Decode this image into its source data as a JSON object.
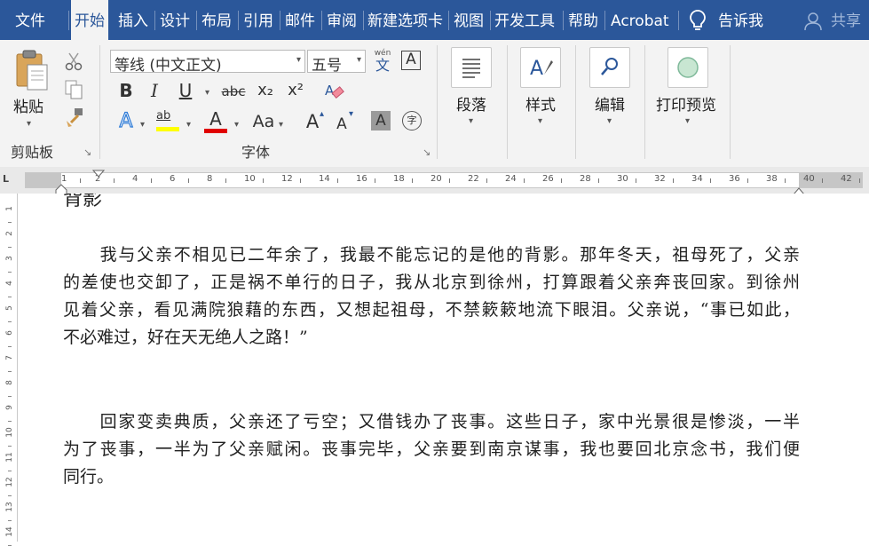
{
  "tabs": {
    "file": "文件",
    "home": "开始",
    "insert": "插入",
    "design": "设计",
    "layout": "布局",
    "references": "引用",
    "mailings": "邮件",
    "review": "审阅",
    "new_tab": "新建选项卡",
    "view": "视图",
    "developer": "开发工具",
    "help": "帮助",
    "acrobat": "Acrobat",
    "tell_me": "告诉我",
    "share": "共享"
  },
  "ribbon": {
    "clipboard": {
      "label": "剪贴板",
      "paste": "粘贴"
    },
    "font": {
      "label": "字体",
      "font_name": "等线 (中文正文)",
      "font_size": "五号",
      "phonetic_top": "wén",
      "phonetic_bottom": "文",
      "char_border": "A",
      "bold": "B",
      "italic": "I",
      "underline": "U",
      "strikethrough": "abc",
      "subscript": "x₂",
      "superscript": "x²",
      "text_effects": "A",
      "highlight": "ab",
      "font_color": "A",
      "change_case": "Aa",
      "grow_font": "A",
      "shrink_font": "A",
      "char_shading": "A",
      "enclose_char": "字"
    },
    "paragraph": {
      "label": "段落"
    },
    "styles": {
      "label": "样式"
    },
    "editing": {
      "label": "编辑"
    },
    "print_preview": {
      "label": "打印预览"
    }
  },
  "ruler": {
    "corner": "L",
    "numbers": [
      "1",
      "2",
      "4",
      "6",
      "8",
      "10",
      "12",
      "14",
      "16",
      "18",
      "20",
      "22",
      "24",
      "26",
      "28",
      "30",
      "32",
      "34",
      "36",
      "38",
      "40",
      "42"
    ],
    "vnumbers": [
      "1",
      "2",
      "3",
      "4",
      "5",
      "6",
      "7",
      "8",
      "9",
      "10",
      "11",
      "12",
      "13",
      "14"
    ]
  },
  "document": {
    "heading_fragment": "背影",
    "paragraph1": [
      "　　我与父亲不相见已二年余了，我最不能忘记的是他的背影。那年冬天，祖母死了，父亲",
      "的差使也交卸了，正是祸不单行的日子，我从北京到徐州，打算跟着父亲奔丧回家。到徐州",
      "见着父亲，看见满院狼藉的东西，又想起祖母，不禁簌簌地流下眼泪。父亲说，“事已如此，",
      "不必难过，好在天无绝人之路！”"
    ],
    "paragraph2": [
      "　　回家变卖典质，父亲还了亏空；又借钱办了丧事。这些日子，家中光景很是惨淡，一半",
      "为了丧事，一半为了父亲赋闲。丧事完毕，父亲要到南京谋事，我也要回北京念书，我们便",
      "同行。"
    ]
  },
  "colors": {
    "tab_bar": "#2b579a",
    "ribbon_bg": "#f3f3f3",
    "highlight_yellow": "#ffff00",
    "font_red": "#e00000"
  }
}
